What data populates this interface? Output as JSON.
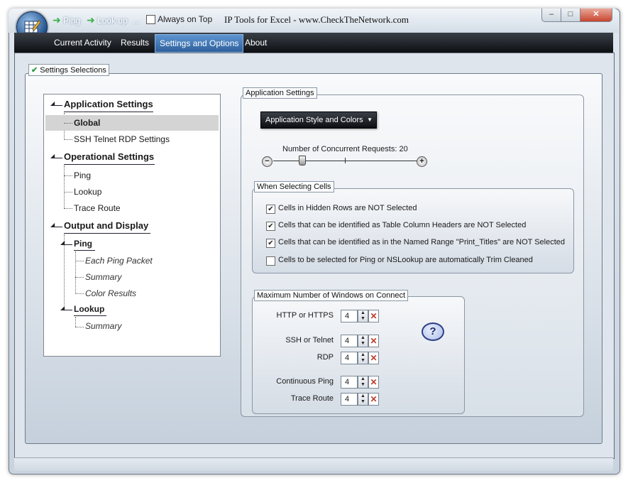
{
  "window": {
    "title": "IP Tools for Excel - www.CheckTheNetwork.com",
    "quick_access": {
      "ping": "Ping",
      "lookup": "Look up",
      "more": "...",
      "always_on_top": "Always on Top"
    },
    "controls": {
      "minimize": "–",
      "maximize": "□",
      "close": "✕"
    }
  },
  "ribbon": {
    "tabs": [
      "Current Activity",
      "Results",
      "Settings and Options",
      "About"
    ],
    "active_tab": "Settings and Options"
  },
  "settings_panel": {
    "title": "Settings Selections"
  },
  "tree": {
    "application_settings": "Application Settings",
    "global": "Global",
    "ssh_telnet_rdp": "SSH  Telnet  RDP Settings",
    "operational_settings": "Operational Settings",
    "ping": "Ping",
    "lookup": "Lookup",
    "trace_route": "Trace Route",
    "output_display": "Output and Display",
    "out_ping": "Ping",
    "each_ping_packet": "Each Ping Packet",
    "summary": "Summary",
    "color_results": "Color Results",
    "out_lookup": "Lookup",
    "lookup_summary": "Summary"
  },
  "app_settings": {
    "group_title": "Application Settings",
    "style_button": "Application Style and Colors",
    "concurrent_label": "Number of Concurrent Requests: 20",
    "concurrent_fraction": 0.25
  },
  "selecting_cells": {
    "group_title": "When Selecting Cells",
    "options": [
      {
        "label": "Cells in Hidden Rows are NOT Selected",
        "checked": true
      },
      {
        "label": "Cells that can be identified as Table Column Headers are NOT Selected",
        "checked": true
      },
      {
        "label": "Cells that can be identified as in the Named Range \"Print_Titles\" are NOT Selected",
        "checked": true
      },
      {
        "label": "Cells to be selected for Ping or NSLookup are automatically Trim Cleaned",
        "checked": false
      }
    ]
  },
  "max_windows": {
    "group_title": "Maximum Number of Windows on Connect",
    "rows": [
      {
        "label": "HTTP or HTTPS",
        "value": "4"
      },
      {
        "label": "SSH or Telnet",
        "value": "4"
      },
      {
        "label": "RDP",
        "value": "4"
      },
      {
        "label": "Continuous Ping",
        "value": "4"
      },
      {
        "label": "Trace Route",
        "value": "4"
      }
    ],
    "help_glyph": "?"
  },
  "colors": {
    "accent": "#2d5f9b",
    "ribbon": "#1b1e23",
    "close_red": "#c9452e"
  }
}
